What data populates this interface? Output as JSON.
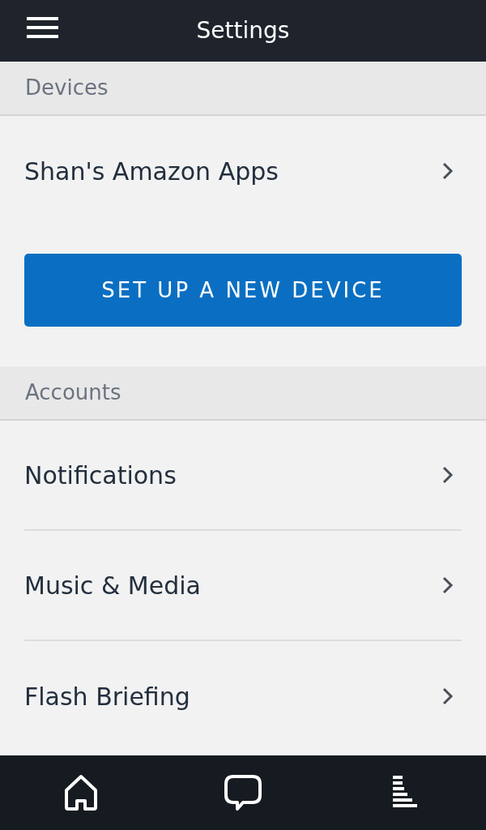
{
  "header": {
    "title": "Settings"
  },
  "sections": [
    {
      "title": "Devices",
      "items": [
        {
          "label": "Shan's Amazon Apps"
        }
      ],
      "button": "SET UP A NEW DEVICE"
    },
    {
      "title": "Accounts",
      "items": [
        {
          "label": "Notifications"
        },
        {
          "label": "Music & Media"
        },
        {
          "label": "Flash Briefing"
        }
      ]
    }
  ],
  "bottom_nav": [
    {
      "kind": "home"
    },
    {
      "kind": "chat"
    },
    {
      "kind": "queue"
    }
  ]
}
